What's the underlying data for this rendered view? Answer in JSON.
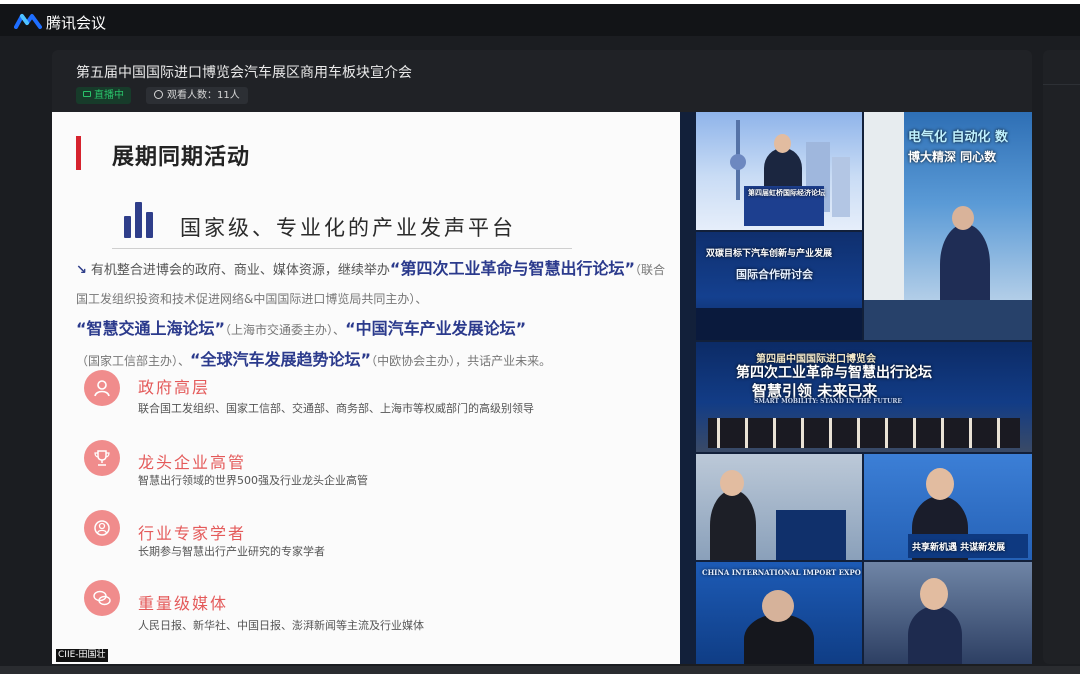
{
  "app": {
    "name": "腾讯会议",
    "logo_icon": "tencent-meeting-logo-icon",
    "accent": "#1e6eff"
  },
  "meeting": {
    "title": "第五届中国国际进口博览会汽车展区商用车板块宣介会",
    "live_label": "直播中",
    "live_icon": "camera-icon",
    "viewers_label": "观看人数：11人",
    "viewers_icon": "eye-icon",
    "status_color": "#29c26a"
  },
  "slide": {
    "heading": "展期同期活动",
    "platform_title": "国家级、专业化的产业发声平台",
    "para": {
      "p1": "有机整合进博会的政府、商业、媒体资源，继续举办",
      "forum1": "“第四次工业革命与智慧出行论坛”",
      "p2": "（联合国工发组织投资和技术促进网络&中国国际进口博览局共同主办）、",
      "forum2": "“智慧交通上海论坛”",
      "p3": "（上海市交通委主办）、",
      "forum3": "“中国汽车产业发展论坛”",
      "p4": "（国家工信部主办）、",
      "forum4": "“全球汽车发展趋势论坛”",
      "p5": "（中欧协会主办），共话产业未来。"
    },
    "audiences": [
      {
        "title": "政府高层",
        "desc": "联合国工发组织、国家工信部、交通部、商务部、上海市等权威部门的高级别领导",
        "icon": "person-icon"
      },
      {
        "title": "龙头企业高管",
        "desc": "智慧出行领域的世界500强及行业龙头企业高管",
        "icon": "trophy-icon"
      },
      {
        "title": "行业专家学者",
        "desc": "长期参与智慧出行产业研究的专家学者",
        "icon": "expert-icon"
      },
      {
        "title": "重量级媒体",
        "desc": "人民日报、新华社、中国日报、澎湃新闻等主流及行业媒体",
        "icon": "chat-bubbles-icon"
      }
    ],
    "accent_red": "#d6232e",
    "accent_blue": "#2b3a8c",
    "icon_pink": "#f08c8c"
  },
  "collage": {
    "banner1": "第四届虹桥国际经济论坛",
    "slogan1": "电气化 自动化 数",
    "slogan1b": "博大精深 同心数",
    "forum_title": "双碳目标下汽车创新与产业发展",
    "forum_sub": "国际合作研讨会",
    "stage_title": "第四届中国国际进口博览会",
    "stage_title2": "第四次工业革命与智慧出行论坛",
    "stage_slogan": "智慧引领 未来已来",
    "stage_en": "SMART MOBILITY: STAND IN THE FUTURE",
    "share_slogan": "共享新机遇 共谋新发展",
    "ciie_en": "CHINA INTERNATIONAL IMPORT EXPO"
  },
  "watermark": "CIIE-田国壮"
}
